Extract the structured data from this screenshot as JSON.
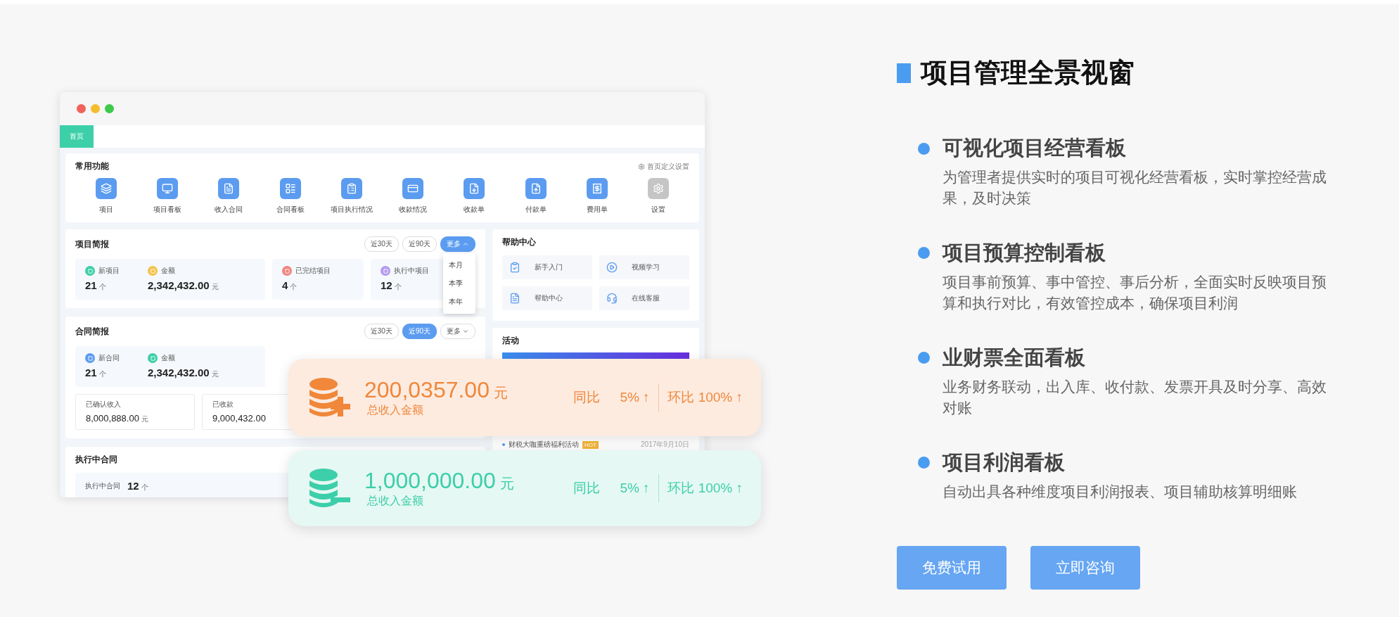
{
  "mockup": {
    "tabs": [
      {
        "label": "首页",
        "selected": true
      }
    ],
    "shortcuts": {
      "title": "常用功能",
      "settings_link": "首页定义设置",
      "items": [
        {
          "label": "项目",
          "kind": "module"
        },
        {
          "label": "项目看板",
          "kind": "module"
        },
        {
          "label": "收入合同",
          "kind": "module"
        },
        {
          "label": "合同看板",
          "kind": "module"
        },
        {
          "label": "项目执行情况",
          "kind": "module"
        },
        {
          "label": "收款情况",
          "kind": "module"
        },
        {
          "label": "收款单",
          "kind": "module"
        },
        {
          "label": "付款单",
          "kind": "module"
        },
        {
          "label": "费用单",
          "kind": "module"
        },
        {
          "label": "设置",
          "kind": "system"
        }
      ]
    },
    "project_brief": {
      "title": "项目简报",
      "filters": [
        {
          "label": "近30天",
          "kind": "range",
          "selected": false
        },
        {
          "label": "近90天",
          "kind": "range",
          "selected": false
        },
        {
          "label": "更多",
          "kind": "dropdown",
          "selected": true,
          "expanded": true
        }
      ],
      "menu": [
        "本月",
        "本季",
        "本年"
      ],
      "panels": [
        {
          "stats": [
            {
              "label": "新项目",
              "value": "21",
              "unit": "个",
              "color": "#3dcfa6"
            },
            {
              "label": "金额",
              "value": "2,342,432.00",
              "unit": "元",
              "color": "#f5c34b"
            }
          ]
        },
        {
          "stats": [
            {
              "label": "已完结项目",
              "value": "4",
              "unit": "个",
              "color": "#f3837e"
            }
          ]
        },
        {
          "stats": [
            {
              "label": "执行中项目",
              "value": "12",
              "unit": "个",
              "color": "#b39af0"
            }
          ]
        }
      ]
    },
    "contract_brief": {
      "title": "合同简报",
      "filters": [
        {
          "label": "近30天",
          "kind": "range",
          "selected": false
        },
        {
          "label": "近90天",
          "kind": "range",
          "selected": true
        },
        {
          "label": "更多",
          "kind": "dropdown",
          "selected": false,
          "expanded": false
        }
      ],
      "panels": [
        {
          "stats": [
            {
              "label": "新合同",
              "value": "21",
              "unit": "个",
              "color": "#5b9cf0"
            },
            {
              "label": "金额",
              "value": "2,342,432.00",
              "unit": "元",
              "color": "#3dcfa6"
            }
          ]
        }
      ],
      "totals": [
        {
          "label": "已确认收入",
          "value": "8,000,888.00",
          "unit": "元"
        },
        {
          "label": "已收款",
          "value": "9,000,432.00"
        }
      ]
    },
    "executing": {
      "title": "执行中合同",
      "label": "执行中合同",
      "value": "12",
      "unit": "个"
    },
    "help": {
      "title": "帮助中心",
      "items": [
        "新手入门",
        "视频学习",
        "帮助中心",
        "在线客服"
      ]
    },
    "activity": {
      "title": "活动",
      "items": [
        {
          "title": "财税大咖重磅福利活动",
          "badge": "HOT",
          "date": "2017年9月10日"
        }
      ]
    }
  },
  "summary_cards": [
    {
      "kind": "income",
      "amount": "200,0357.00",
      "unit": "元",
      "label": "总收入金额",
      "yoy_label": "同比",
      "yoy": "5% ↑",
      "mom_label": "环比",
      "mom": "100% ↑"
    },
    {
      "kind": "expense",
      "amount": "1,000,000.00",
      "unit": "元",
      "label": "总收入金额",
      "yoy_label": "同比",
      "yoy": "5% ↑",
      "mom_label": "环比",
      "mom": "100% ↑"
    }
  ],
  "feature": {
    "title": "项目管理全景视窗",
    "items": [
      {
        "heading": "可视化项目经营看板",
        "description": "为管理者提供实时的项目可视化经营看板，实时掌控经营成果，及时决策"
      },
      {
        "heading": "项目预算控制看板",
        "description": "项目事前预算、事中管控、事后分析，全面实时反映项目预算和执行对比，有效管控成本，确保项目利润"
      },
      {
        "heading": "业财票全面看板",
        "description": "业务财务联动，出入库、收付款、发票开具及时分享、高效对账"
      },
      {
        "heading": "项目利润看板",
        "description": "自动出具各种维度项目利润报表、项目辅助核算明细账"
      }
    ],
    "buttons": [
      "免费试用",
      "立即咨询"
    ]
  }
}
